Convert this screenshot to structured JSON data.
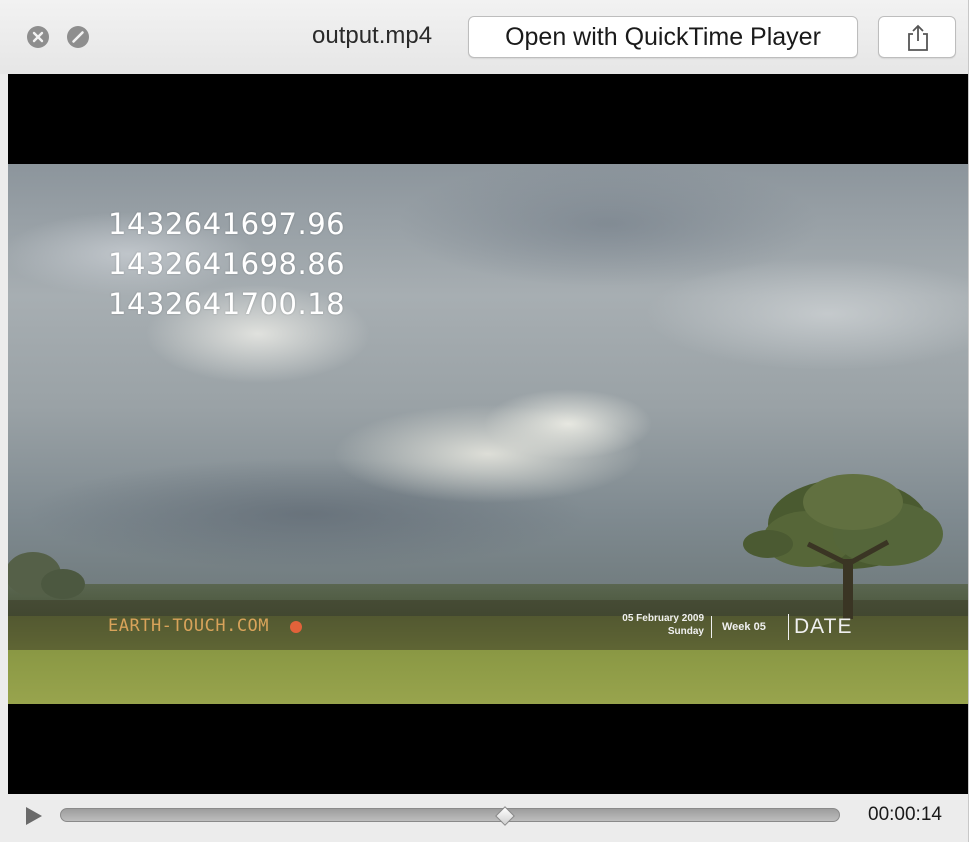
{
  "window": {
    "filename": "output.mp4",
    "open_button_label": "Open with QuickTime Player",
    "share_icon": "share-icon",
    "close_icon": "close-icon",
    "minimize_icon": "minimize-icon"
  },
  "video": {
    "timestamps": [
      "1432641697.96",
      "1432641698.86",
      "1432641700.18"
    ],
    "logo_text": "EARTH-TOUCH.COM",
    "date_line1": "05 February 2009",
    "date_line2": "Sunday",
    "week": "Week 05",
    "date_label": "DATE"
  },
  "controls": {
    "play_icon": "play-icon",
    "progress": 0.57,
    "timecode": "00:00:14"
  },
  "colors": {
    "logo": "#d8a35a",
    "accent_dot": "#e2623a"
  }
}
